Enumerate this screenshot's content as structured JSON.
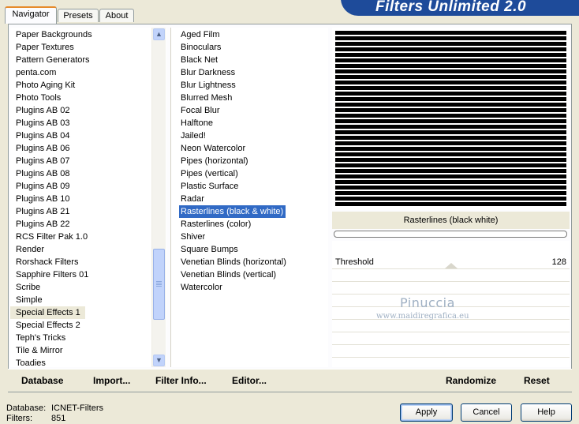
{
  "tabs": [
    "Navigator",
    "Presets",
    "About"
  ],
  "banner": "Filters Unlimited 2.0",
  "categories": [
    "Paper Backgrounds",
    "Paper Textures",
    "Pattern Generators",
    "penta.com",
    "Photo Aging Kit",
    "Photo Tools",
    "Plugins AB 02",
    "Plugins AB 03",
    "Plugins AB 04",
    "Plugins AB 06",
    "Plugins AB 07",
    "Plugins AB 08",
    "Plugins AB 09",
    "Plugins AB 10",
    "Plugins AB 21",
    "Plugins AB 22",
    "RCS Filter Pak 1.0",
    "Render",
    "Rorshack Filters",
    "Sapphire Filters 01",
    "Scribe",
    "Simple",
    "Special Effects 1",
    "Special Effects 2",
    "Teph's Tricks",
    "Tile & Mirror",
    "Toadies"
  ],
  "filters": [
    "Aged Film",
    "Binoculars",
    "Black Net",
    "Blur Darkness",
    "Blur Lightness",
    "Blurred Mesh",
    "Focal Blur",
    "Halftone",
    "Jailed!",
    "Neon Watercolor",
    "Pipes (horizontal)",
    "Pipes (vertical)",
    "Plastic Surface",
    "Radar",
    "Rasterlines (black & white)",
    "Rasterlines (color)",
    "Shiver",
    "Square Bumps",
    "Venetian Blinds (horizontal)",
    "Venetian Blinds (vertical)",
    "Watercolor"
  ],
  "preview": {
    "filter_name": "Rasterlines (black  white)",
    "param_label": "Threshold",
    "param_value": "128"
  },
  "watermark": {
    "line1": "Pinuccia",
    "line2": "www.maidiregrafica.eu"
  },
  "bottom_buttons": {
    "database": "Database",
    "import": "Import...",
    "filter_info": "Filter Info...",
    "editor": "Editor...",
    "randomize": "Randomize",
    "reset": "Reset"
  },
  "status": {
    "db_label": "Database:",
    "db_value": "ICNET-Filters",
    "filters_label": "Filters:",
    "filters_value": "851"
  },
  "dialog_buttons": {
    "apply": "Apply",
    "cancel": "Cancel",
    "help": "Help"
  }
}
